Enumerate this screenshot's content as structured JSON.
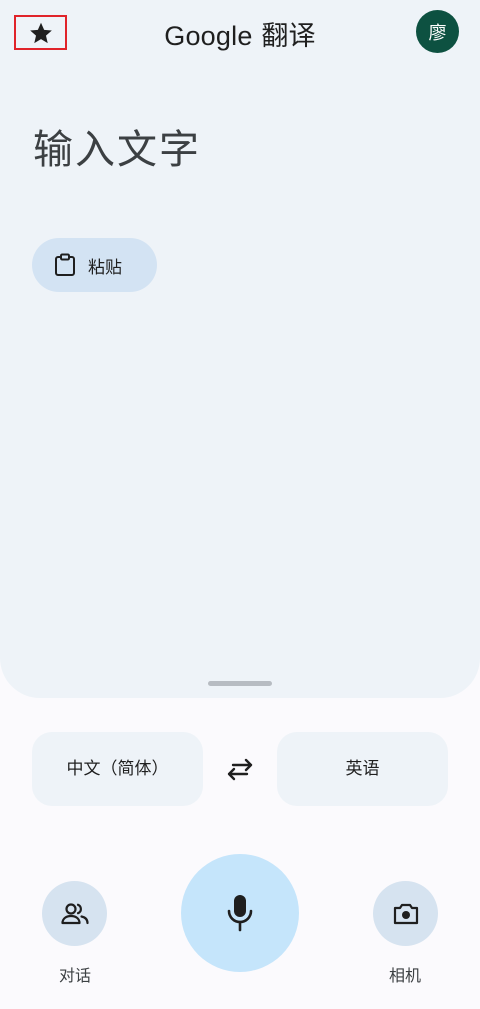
{
  "header": {
    "brand": "Google",
    "title_suffix": "翻译",
    "avatar_initial": "廖"
  },
  "input": {
    "placeholder": "输入文字",
    "paste_label": "粘贴"
  },
  "languages": {
    "source": "中文（简体）",
    "target": "英语"
  },
  "actions": {
    "conversation_label": "对话",
    "camera_label": "相机"
  },
  "colors": {
    "panel_bg": "#eef3f8",
    "avatar_bg": "#0d5141",
    "mic_bg": "#c5e5fb",
    "chip_bg": "#d3e3f3",
    "highlight_border": "#e0232a"
  },
  "icons": [
    "star-icon",
    "clipboard-icon",
    "swap-icon",
    "people-icon",
    "microphone-icon",
    "camera-icon"
  ]
}
